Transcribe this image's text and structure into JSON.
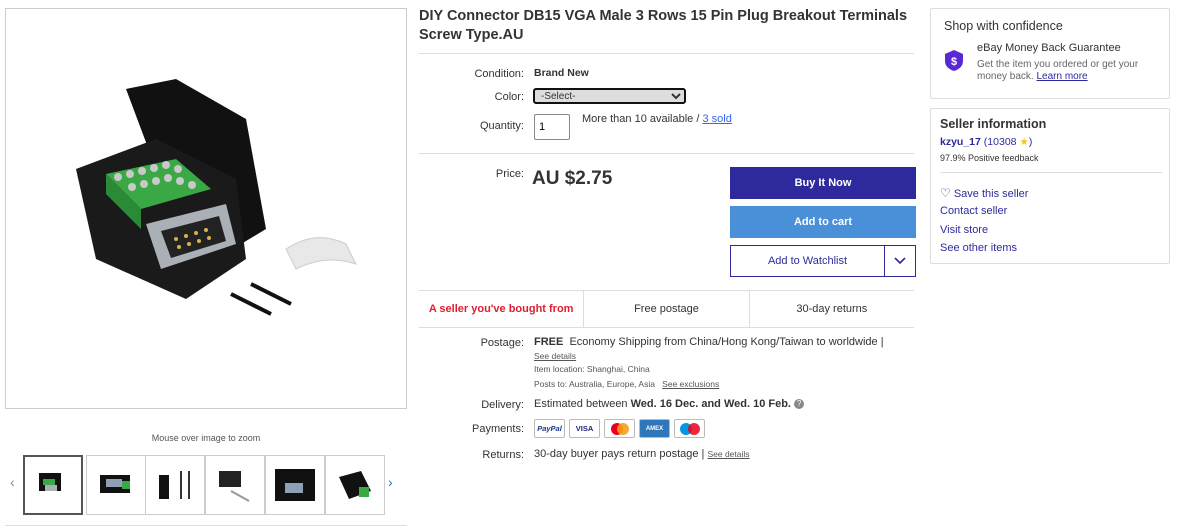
{
  "gallery": {
    "zoom_hint": "Mouse over image to zoom"
  },
  "listing": {
    "title": "DIY Connector DB15 VGA Male 3 Rows 15 Pin Plug Breakout Terminals Screw Type.AU",
    "condition_label": "Condition:",
    "condition_value": "Brand New",
    "color_label": "Color:",
    "color_select": "-Select-",
    "quantity_label": "Quantity:",
    "quantity_value": "1",
    "availability": "More than 10 available /",
    "sold_link": "3 sold",
    "price_label": "Price:",
    "price": "AU $2.75"
  },
  "actions": {
    "buy_now": "Buy It Now",
    "add_to_cart": "Add to cart",
    "add_to_watchlist": "Add to Watchlist"
  },
  "badges": [
    "A seller you've bought from",
    "Free postage",
    "30-day returns"
  ],
  "shipping": {
    "postage_label": "Postage:",
    "postage_free": "FREE",
    "postage_desc": "Economy Shipping from China/Hong Kong/Taiwan to worldwide |",
    "see_details": "See details",
    "item_location": "Item location:  Shanghai, China",
    "posts_to": "Posts to:  Australia, Europe, Asia",
    "see_exclusions": "See exclusions",
    "delivery_label": "Delivery:",
    "delivery_prefix": "Estimated between",
    "delivery_dates": "Wed. 16 Dec. and Wed. 10 Feb.",
    "payments_label": "Payments:",
    "payment_methods": [
      "PayPal",
      "VISA",
      "Mastercard",
      "AmEx",
      "Maestro"
    ],
    "returns_label": "Returns:",
    "returns_desc": "30-day buyer pays return postage |",
    "returns_details": "See details"
  },
  "confidence": {
    "title": "Shop with confidence",
    "mbg_title": "eBay Money Back Guarantee",
    "mbg_sub": "Get the item you ordered or get your money back.",
    "learn_more": "Learn more"
  },
  "seller": {
    "title": "Seller information",
    "name": "kzyu_17",
    "score_open": "(",
    "score": "10308",
    "score_close": ")",
    "feedback": "97.9% Positive feedback",
    "save": "Save this seller",
    "contact": "Contact seller",
    "visit": "Visit store",
    "other": "See other items"
  },
  "colors": {
    "primary": "#2e2a9e",
    "cart": "#4a90d9",
    "link": "#3665f3",
    "red": "#dd1e31"
  }
}
